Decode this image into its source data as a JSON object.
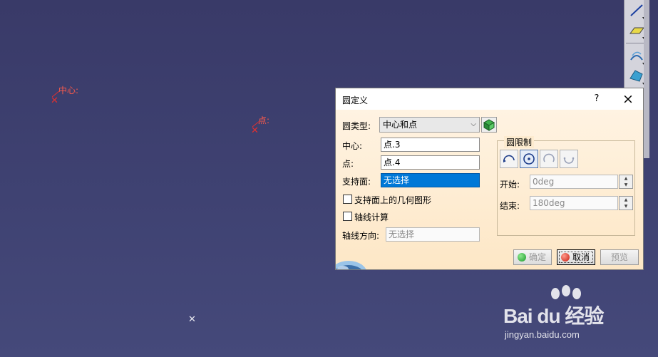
{
  "viewport": {
    "point_labels": {
      "center": "中心:",
      "point": "点:"
    }
  },
  "dialog": {
    "title": "圆定义",
    "help_label": "?",
    "close_label": "×",
    "circle_type": {
      "label": "圆类型:",
      "value": "中心和点"
    },
    "center": {
      "label": "中心:",
      "value": "点.3"
    },
    "point": {
      "label": "点:",
      "value": "点.4"
    },
    "support": {
      "label": "支持面:",
      "value": "无选择"
    },
    "geometry_on_support": {
      "label": "支持面上的几何图形",
      "checked": false
    },
    "axis_computation": {
      "label": "轴线计算",
      "checked": false
    },
    "axis_direction": {
      "label": "轴线方向:",
      "value": "无选择"
    },
    "limits": {
      "legend": "圆限制",
      "start": {
        "label": "开始:",
        "value": "0deg"
      },
      "end": {
        "label": "结束:",
        "value": "180deg"
      }
    },
    "buttons": {
      "ok": "确定",
      "cancel": "取消",
      "preview": "预览"
    }
  },
  "watermark": {
    "brand": "Bai du 经验",
    "url": "jingyan.baidu.com"
  },
  "colors": {
    "viewport_bg": "#3d3f6e",
    "marker": "#e03030",
    "dialog_bg": "#fde9cc",
    "selection": "#0078d7"
  }
}
